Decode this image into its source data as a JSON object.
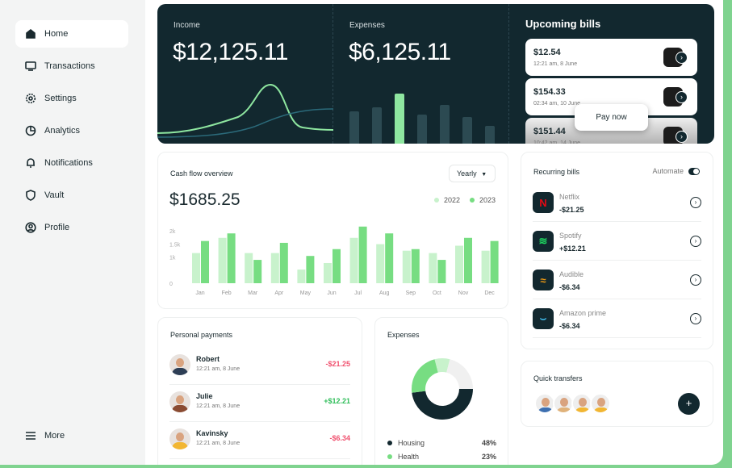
{
  "sidebar": {
    "items": [
      {
        "label": "Home",
        "icon": "home-icon"
      },
      {
        "label": "Transactions",
        "icon": "transactions-icon"
      },
      {
        "label": "Settings",
        "icon": "gear-icon"
      },
      {
        "label": "Analytics",
        "icon": "pie-chart-icon"
      },
      {
        "label": "Notifications",
        "icon": "bell-icon"
      },
      {
        "label": "Vault",
        "icon": "shield-icon"
      },
      {
        "label": "Profile",
        "icon": "user-icon"
      }
    ],
    "more": "More"
  },
  "income": {
    "label": "Income",
    "value": "$12,125.11"
  },
  "expenses_stat": {
    "label": "Expenses",
    "value": "$6,125.11"
  },
  "upcoming": {
    "title": "Upcoming bills",
    "pay_now": "Pay now",
    "bills": [
      {
        "amount": "$12.54",
        "time": "12:21 am, 8 June"
      },
      {
        "amount": "$154.33",
        "time": "02:34 am, 10 June"
      },
      {
        "amount": "$151.44",
        "time": "10:42 am, 14 June"
      }
    ]
  },
  "cashflow": {
    "title": "Cash flow overview",
    "period": "Yearly",
    "total": "$1685.25"
  },
  "chart_data": {
    "type": "bar",
    "categories": [
      "Jan",
      "Feb",
      "Mar",
      "Apr",
      "May",
      "Jun",
      "Jul",
      "Aug",
      "Sep",
      "Oct",
      "Nov",
      "Dec"
    ],
    "yticks": [
      "0",
      "1k",
      "1.5k",
      "2k"
    ],
    "ylim": [
      0,
      2000
    ],
    "legend": "top-right",
    "series": [
      {
        "name": "2022",
        "color": "#c8f2cc",
        "values": [
          1150,
          1730,
          1150,
          1150,
          520,
          770,
          1730,
          1490,
          1240,
          1150,
          1430,
          1240
        ]
      },
      {
        "name": "2023",
        "color": "#77dd82",
        "values": [
          1610,
          1900,
          890,
          1540,
          1040,
          1300,
          2160,
          1900,
          1300,
          890,
          1730,
          1610
        ]
      }
    ]
  },
  "recurring": {
    "title": "Recurring bills",
    "automate": "Automate",
    "items": [
      {
        "name": "Netflix",
        "amount": "-$21.25",
        "icon": "netflix-icon"
      },
      {
        "name": "Spotify",
        "amount": "+$12.21",
        "icon": "spotify-icon"
      },
      {
        "name": "Audible",
        "amount": "-$6.34",
        "icon": "audible-icon"
      },
      {
        "name": "Amazon prime",
        "amount": "-$6.34",
        "icon": "prime-icon"
      }
    ]
  },
  "personal": {
    "title": "Personal payments",
    "items": [
      {
        "name": "Robert",
        "time": "12:21 am, 8 June",
        "amount": "-$21.25",
        "positive": false
      },
      {
        "name": "Julie",
        "time": "12:21 am, 8 June",
        "amount": "+$12.21",
        "positive": true
      },
      {
        "name": "Kavinsky",
        "time": "12:21 am, 8 June",
        "amount": "-$6.34",
        "positive": false
      }
    ]
  },
  "expenses": {
    "title": "Expenses",
    "items": [
      {
        "label": "Housing",
        "pct": "48%",
        "value": 48,
        "color": "#12282f"
      },
      {
        "label": "Health",
        "pct": "23%",
        "value": 23,
        "color": "#77dd82"
      }
    ]
  },
  "quick": {
    "title": "Quick transfers"
  },
  "colors": {
    "dark": "#12282f",
    "green": "#77dd82",
    "negative": "#f0506e",
    "positive": "#2ebd59"
  }
}
